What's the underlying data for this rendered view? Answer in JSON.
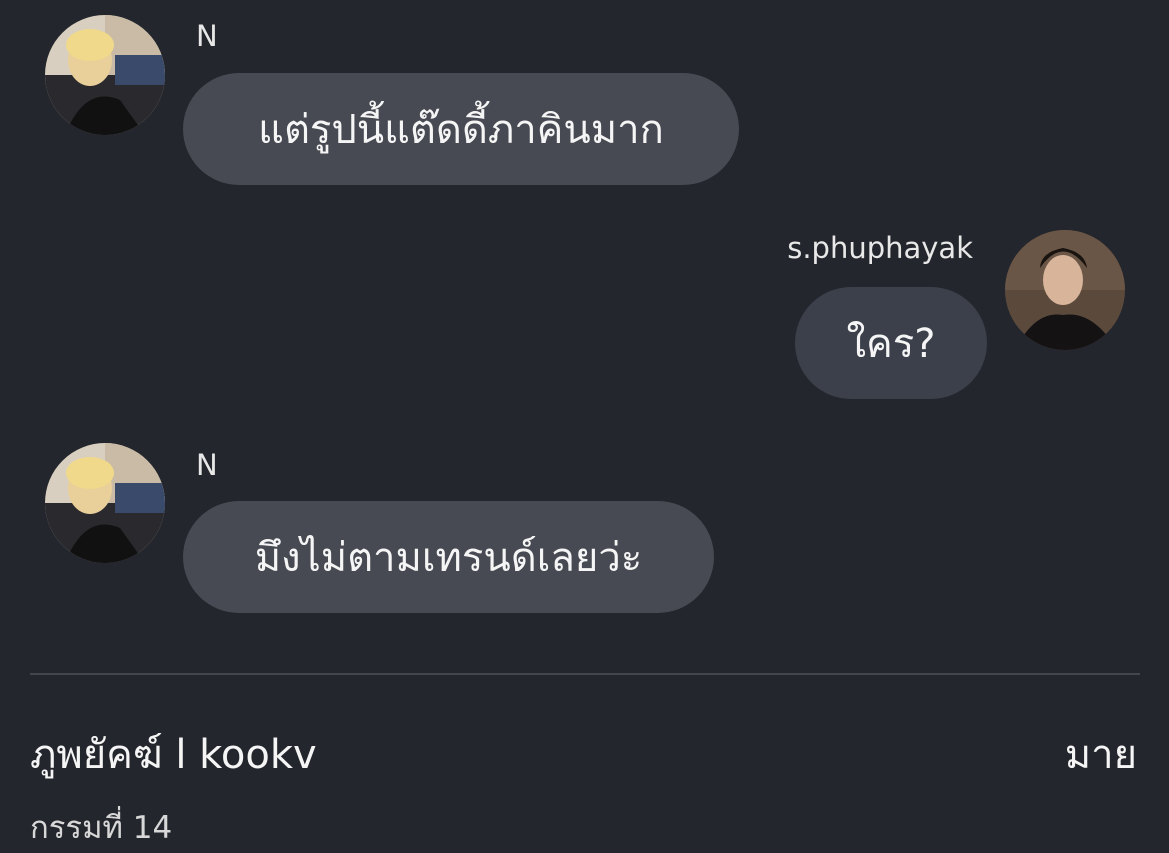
{
  "messages": [
    {
      "sender": "N",
      "text": "แต่รูปนี้แต๊ดดี้ภาคินมาก",
      "side": "left",
      "avatar": "avatar-photo-blonde"
    },
    {
      "sender": "s.phuphayak",
      "text": "ใคร?",
      "side": "right",
      "avatar": "avatar-photo-dark-hair"
    },
    {
      "sender": "N",
      "text": "มึงไม่ตามเทรนด์เลยว่ะ",
      "side": "left",
      "avatar": "avatar-photo-blonde"
    }
  ],
  "footer": {
    "title": "ภูพยัคฆ์ l kookv",
    "author": "มาย",
    "chapter": "กรรมที่ 14"
  },
  "colors": {
    "background": "#24262d",
    "bubble_left": "#474a52",
    "bubble_right": "#3b404b",
    "text": "#f5f5f5"
  }
}
